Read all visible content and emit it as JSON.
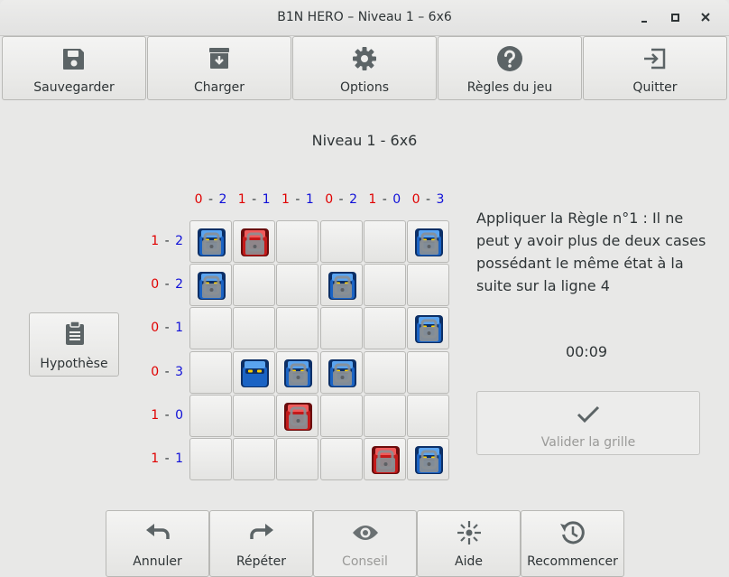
{
  "window": {
    "title": "B1N HERO – Niveau 1 – 6x6"
  },
  "toolbar": {
    "save_label": "Sauvegarder",
    "load_label": "Charger",
    "options_label": "Options",
    "rules_label": "Règles du jeu",
    "quit_label": "Quitter"
  },
  "level_title": "Niveau 1 - 6x6",
  "columns": [
    {
      "a": "0",
      "b": "2"
    },
    {
      "a": "1",
      "b": "1"
    },
    {
      "a": "1",
      "b": "1"
    },
    {
      "a": "0",
      "b": "2"
    },
    {
      "a": "1",
      "b": "0"
    },
    {
      "a": "0",
      "b": "3"
    }
  ],
  "rows": [
    {
      "a": "1",
      "b": "2"
    },
    {
      "a": "0",
      "b": "2"
    },
    {
      "a": "0",
      "b": "1"
    },
    {
      "a": "0",
      "b": "3"
    },
    {
      "a": "1",
      "b": "0"
    },
    {
      "a": "1",
      "b": "1"
    }
  ],
  "grid": [
    [
      "blue-locked",
      "red-locked",
      "",
      "",
      "",
      "blue-locked"
    ],
    [
      "blue-locked",
      "",
      "",
      "blue-locked",
      "",
      ""
    ],
    [
      "",
      "",
      "",
      "",
      "",
      "blue-locked"
    ],
    [
      "",
      "blue",
      "blue-locked",
      "blue-locked",
      "",
      ""
    ],
    [
      "",
      "",
      "red-locked",
      "",
      "",
      ""
    ],
    [
      "",
      "",
      "",
      "",
      "red-locked",
      "blue-locked"
    ]
  ],
  "colors": {
    "red": "#e00000",
    "blue": "#1010d8"
  },
  "hypothesis_label": "Hypothèse",
  "hint_text": "Appliquer la Règle n°1 : Il ne peut y avoir plus de deux cases possédant le même état à la suite sur la ligne 4",
  "timer": "00:09",
  "validate_label": "Valider la grille",
  "bottom": {
    "undo_label": "Annuler",
    "redo_label": "Répéter",
    "advice_label": "Conseil",
    "help_label": "Aide",
    "restart_label": "Recommencer"
  },
  "icons": {
    "save": "floppy-icon",
    "load": "archive-download-icon",
    "options": "gear-icon",
    "rules": "question-icon",
    "quit": "exit-icon",
    "hypothesis": "clipboard-icon",
    "validate": "check-icon",
    "undo": "undo-icon",
    "redo": "redo-icon",
    "advice": "eye-icon",
    "help": "sparkle-icon",
    "restart": "history-icon"
  }
}
